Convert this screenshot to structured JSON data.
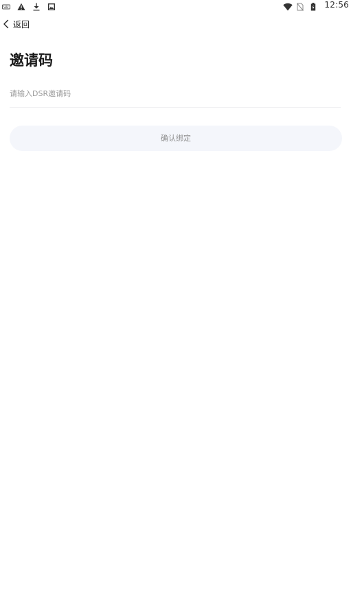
{
  "status_bar": {
    "time": "12:56",
    "left_icons": [
      "keyboard-icon",
      "warning-icon",
      "download-icon",
      "gallery-icon"
    ],
    "right_icons": [
      "wifi-icon",
      "no-sim-icon",
      "battery-icon"
    ]
  },
  "header": {
    "back_label": "返回"
  },
  "page": {
    "title": "邀请码"
  },
  "form": {
    "invite_placeholder": "请输入DSR邀请码",
    "invite_value": "",
    "confirm_label": "确认绑定"
  },
  "colors": {
    "button_background": "#f4f6fb",
    "button_text": "#8e8e8e",
    "placeholder_text": "#9a9a9a",
    "title_text": "#1c1c1c"
  }
}
